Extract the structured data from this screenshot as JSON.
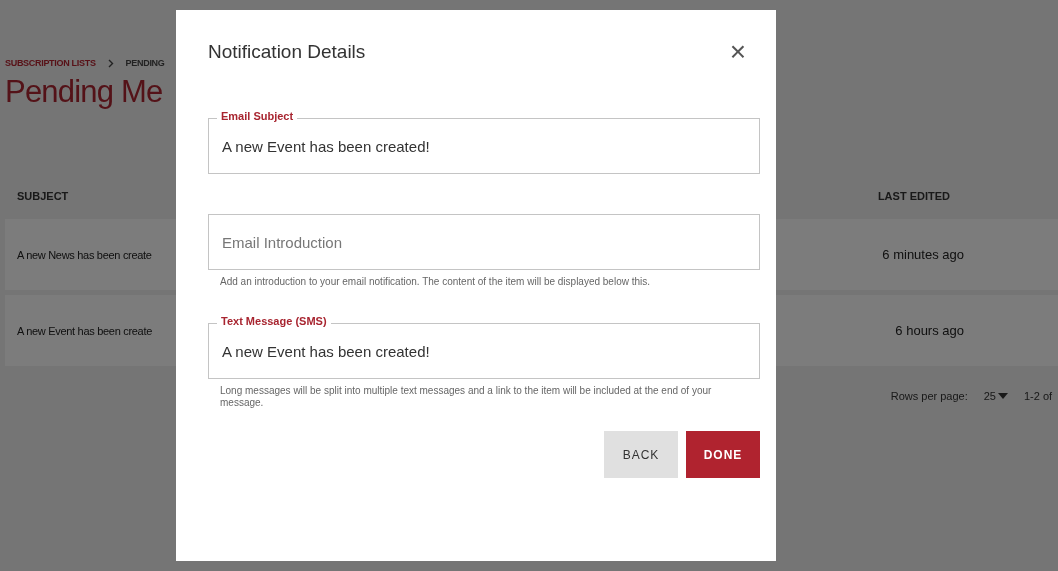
{
  "breadcrumb": [
    {
      "label": "SUBSCRIPTION LISTS",
      "kind": "link"
    },
    {
      "label": "PENDING",
      "kind": "current"
    }
  ],
  "page_title": "Pending Me",
  "table": {
    "columns": [
      "SUBJECT",
      "LAST EDITED"
    ],
    "rows": [
      {
        "subject": "A new News has been create",
        "last_edited": "6 minutes ago"
      },
      {
        "subject": "A new Event has been create",
        "last_edited": "6 hours ago"
      }
    ]
  },
  "pagination": {
    "rows_per_page_label": "Rows per page:",
    "rows_per_page": "25",
    "range": "1-2 of"
  },
  "dialog": {
    "title": "Notification Details",
    "close": "×",
    "fields": [
      {
        "label": "Email Subject",
        "value": "A new Event has been created!"
      },
      {
        "placeholder": "Email Introduction",
        "helper": "Add an introduction to your email notification. The content of the item will be displayed below this."
      },
      {
        "label": "Text Message (SMS)",
        "value": "A new Event has been created!",
        "helper": "Long messages will be split into multiple text messages and a link to the item will be included at the end of your message."
      }
    ],
    "buttons": [
      {
        "label": "BACK",
        "kind": "secondary"
      },
      {
        "label": "DONE",
        "kind": "primary"
      }
    ]
  }
}
